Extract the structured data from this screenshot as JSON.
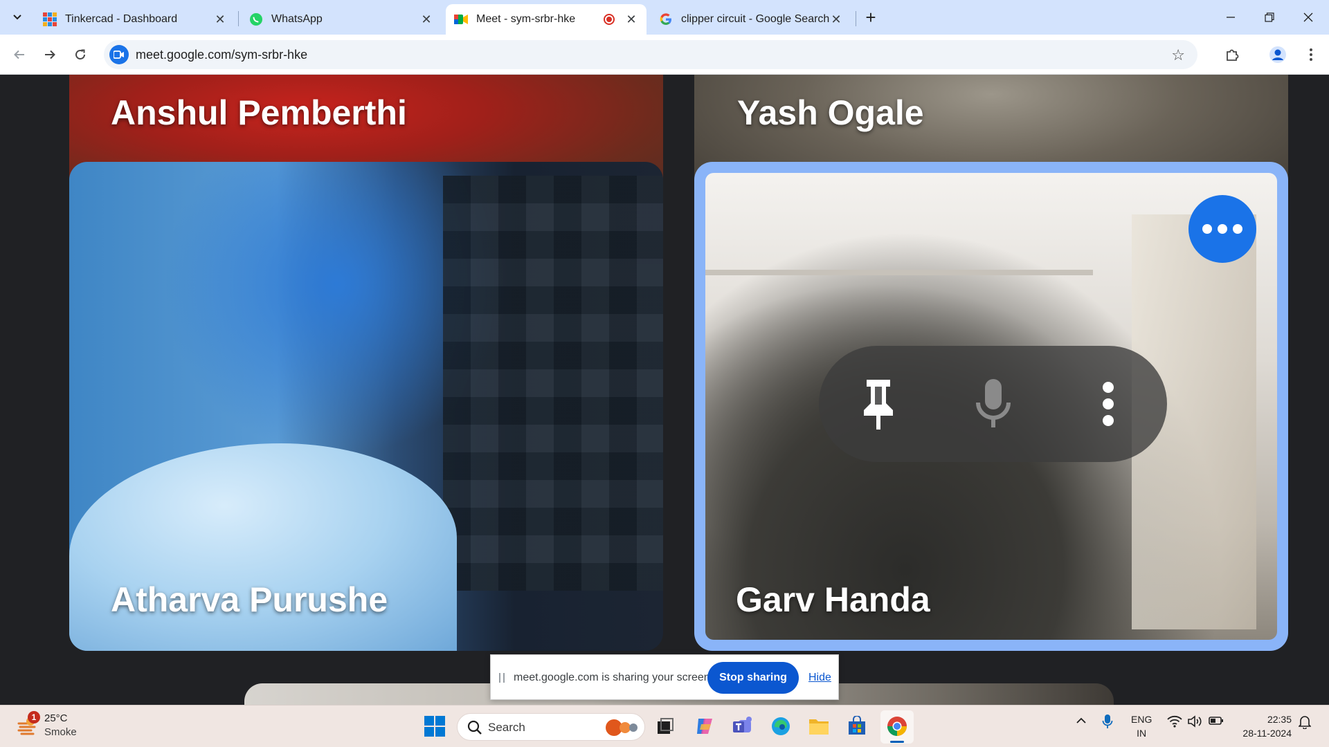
{
  "browser": {
    "tabs": [
      {
        "title": "Tinkercad - Dashboard",
        "active": false
      },
      {
        "title": "WhatsApp",
        "active": false
      },
      {
        "title": "Meet - sym-srbr-hke",
        "active": true,
        "recording": true
      },
      {
        "title": "clipper circuit - Google Search",
        "active": false
      }
    ],
    "url": "meet.google.com/sym-srbr-hke"
  },
  "meet": {
    "participants": [
      {
        "name": "Anshul Pemberthi"
      },
      {
        "name": "Yash Ogale"
      },
      {
        "name": "Atharva Purushe"
      },
      {
        "name": "Garv Handa",
        "highlighted": true
      }
    ]
  },
  "share_bar": {
    "message": "meet.google.com is sharing your screen.",
    "stop_label": "Stop sharing",
    "hide_label": "Hide"
  },
  "taskbar": {
    "weather": {
      "badge": "1",
      "temperature": "25°C",
      "condition": "Smoke"
    },
    "search_label": "Search",
    "language_line1": "ENG",
    "language_line2": "IN",
    "time": "22:35",
    "date": "28-11-2024"
  },
  "colors": {
    "tabstrip": "#d3e3fd",
    "meet_bg": "#202124",
    "active_speaker_border": "#8ab4f8",
    "accent_blue": "#1a73e8",
    "stop_button": "#0b57d0",
    "taskbar": "#f0e6e2"
  },
  "icons": {
    "tab_search": "chevron-down-icon",
    "pin": "pin-icon",
    "mic": "microphone-icon",
    "more": "more-vert-icon",
    "tile_more": "more-horiz-icon"
  }
}
